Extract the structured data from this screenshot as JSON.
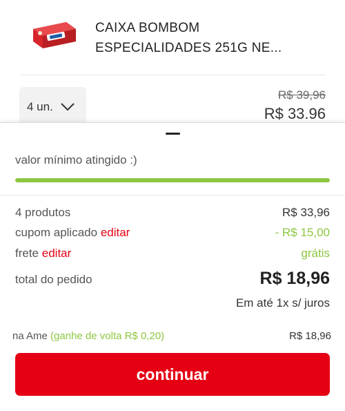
{
  "product": {
    "name_line1": "CAIXA BOMBOM",
    "name_line2": "ESPECIALIDADES 251G NE...",
    "quantity": "4 un.",
    "old_price": "R$ 39,96",
    "price": "R$ 33.96",
    "thumbnail_colors": [
      "#d7262b",
      "#ffffff",
      "#1c5ea8"
    ]
  },
  "summary": {
    "min_message": "valor mínimo atingido :)",
    "progress_fraction": 1.0,
    "progress_color": "#8dc63f",
    "products_label": "4 produtos",
    "products_value": "R$ 33,96",
    "coupon_label": "cupom aplicado",
    "coupon_edit": "editar",
    "coupon_value": "- R$ 15,00",
    "shipping_label": "frete",
    "shipping_edit": "editar",
    "shipping_value": "grátis",
    "total_label": "total do pedido",
    "total_value": "R$ 18,96",
    "installments": "Em até 1x s/ juros"
  },
  "ame": {
    "label": "na Ame",
    "cashback": "(ganhe de volta R$ 0,20)",
    "value": "R$ 18,96"
  },
  "actions": {
    "continue_label": "continuar"
  },
  "colors": {
    "accent_red": "#e60014",
    "accent_green": "#8dc63f"
  },
  "icons": {
    "quantity_dropdown": "chevron-down-icon",
    "sheet_handle": "drag-handle-icon"
  }
}
